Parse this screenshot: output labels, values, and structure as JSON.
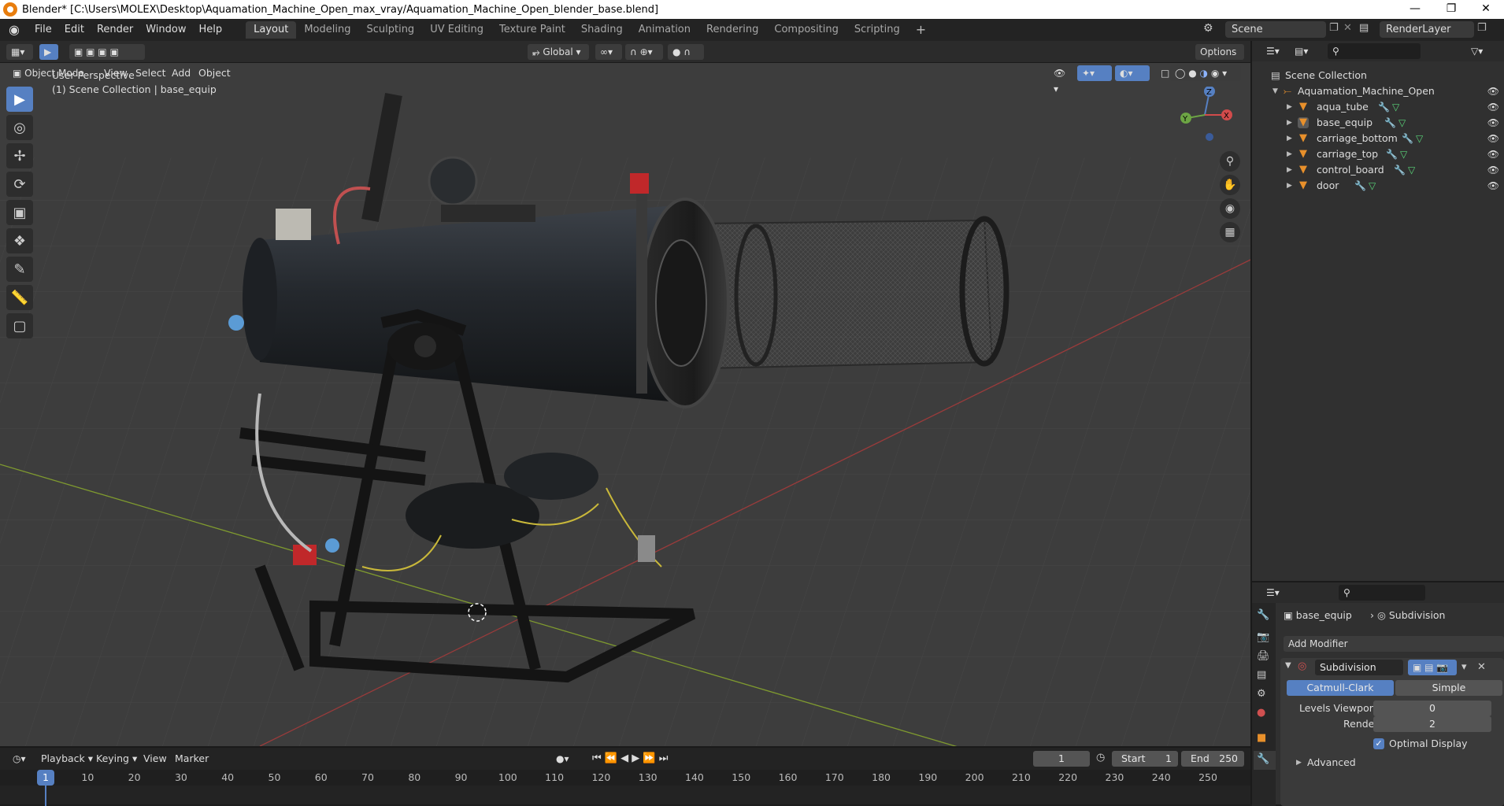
{
  "window": {
    "title": "Blender* [C:\\Users\\MOLEX\\Desktop\\Aquamation_Machine_Open_max_vray/Aquamation_Machine_Open_blender_base.blend]"
  },
  "menu": [
    "File",
    "Edit",
    "Render",
    "Window",
    "Help"
  ],
  "workspaces": [
    "Layout",
    "Modeling",
    "Sculpting",
    "UV Editing",
    "Texture Paint",
    "Shading",
    "Animation",
    "Rendering",
    "Compositing",
    "Scripting"
  ],
  "scene": {
    "name": "Scene",
    "layer": "RenderLayer"
  },
  "tool_header": {
    "orientation": "Global",
    "options": "Options"
  },
  "viewport_header": {
    "mode": "Object Mode",
    "menus": [
      "View",
      "Select",
      "Add",
      "Object"
    ]
  },
  "overlay": {
    "perspective": "User Perspective",
    "context": "(1) Scene Collection | base_equip"
  },
  "gizmo": {
    "z": "Z",
    "y": "Y",
    "x": "X"
  },
  "outliner": {
    "root": "Scene Collection",
    "collection": "Aquamation_Machine_Open",
    "items": [
      "aqua_tube",
      "base_equip",
      "carriage_bottom",
      "carriage_top",
      "control_board",
      "door"
    ]
  },
  "properties": {
    "object": "base_equip",
    "modifier_breadcrumb": "Subdivision",
    "add_modifier": "Add Modifier",
    "modifier_name": "Subdivision",
    "algo_a": "Catmull-Clark",
    "algo_b": "Simple",
    "levels_viewport_label": "Levels Viewport",
    "levels_viewport": "0",
    "render_label": "Render",
    "render": "2",
    "optimal_display": "Optimal Display",
    "advanced": "Advanced"
  },
  "timeline": {
    "menus": [
      "Playback",
      "Keying",
      "View",
      "Marker"
    ],
    "current_frame": "1",
    "start_label": "Start",
    "start": "1",
    "end_label": "End",
    "end": "250",
    "ticks": [
      "1",
      "10",
      "20",
      "30",
      "40",
      "50",
      "60",
      "70",
      "80",
      "90",
      "100",
      "110",
      "120",
      "130",
      "140",
      "150",
      "160",
      "170",
      "180",
      "190",
      "200",
      "210",
      "220",
      "230",
      "240",
      "250"
    ]
  }
}
